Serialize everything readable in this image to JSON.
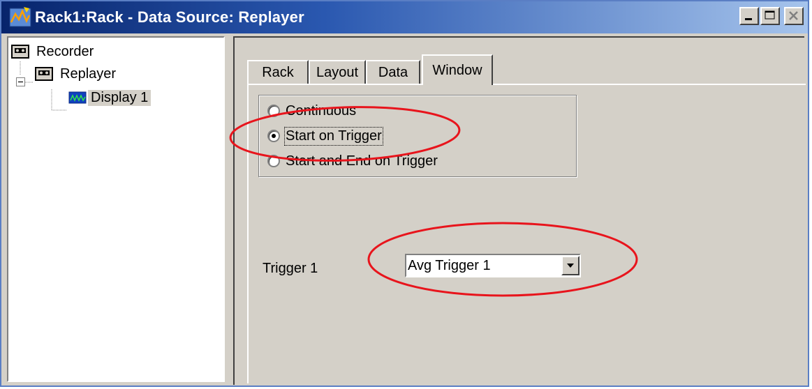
{
  "window": {
    "title": "Rack1:Rack - Data Source: Replayer",
    "controls": [
      "minimize-icon",
      "maximize-icon",
      "close-icon"
    ]
  },
  "tree": {
    "items": [
      {
        "label": "Recorder",
        "icon": "recorder-icon"
      },
      {
        "label": "Replayer",
        "icon": "replayer-icon",
        "expanded": true
      },
      {
        "label": "Display 1",
        "icon": "display-icon",
        "selected": true
      }
    ]
  },
  "tabs": [
    {
      "label": "Rack"
    },
    {
      "label": "Layout"
    },
    {
      "label": "Data"
    },
    {
      "label": "Window",
      "active": true
    }
  ],
  "mode": {
    "options": [
      {
        "label": "Continuous",
        "checked": false
      },
      {
        "label": "Start on Trigger",
        "checked": true
      },
      {
        "label": "Start and End on Trigger",
        "checked": false
      }
    ]
  },
  "trigger": {
    "label": "Trigger 1",
    "selected_value": "Avg Trigger 1"
  },
  "colors": {
    "titlebar_start": "#07246b",
    "titlebar_end": "#a6c4ec",
    "face": "#d4d0c8",
    "annotation": "#e8141c"
  }
}
